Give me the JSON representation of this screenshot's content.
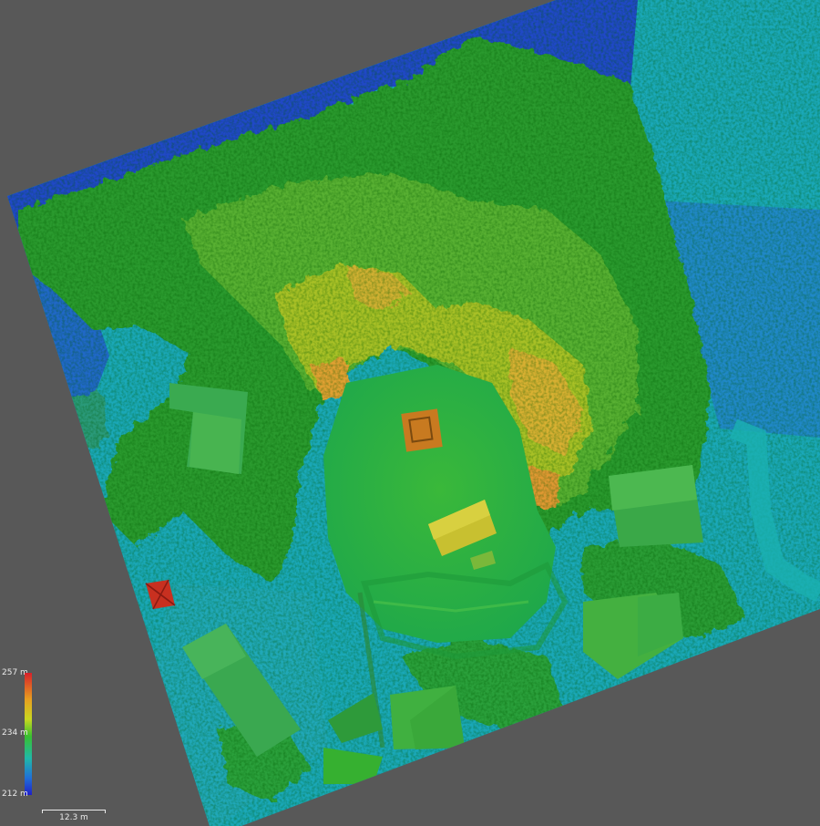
{
  "legend": {
    "max_label": "257 m",
    "mid_label": "234 m",
    "min_label": "212 m",
    "colors": [
      "#d8202a",
      "#e8a020",
      "#c8d820",
      "#38c030",
      "#20b8a8",
      "#2070d8",
      "#2020c8"
    ]
  },
  "scale": {
    "label": "12.3 m"
  },
  "colors": {
    "background": "#585858",
    "low_ground": "#2050c8",
    "mid_ground": "#18a8b8",
    "canopy": "#2c9a30",
    "high_canopy": "#c8a020",
    "roof_green": "#3cb040",
    "roof_yellow": "#c8c030",
    "roof_red": "#c83020"
  }
}
